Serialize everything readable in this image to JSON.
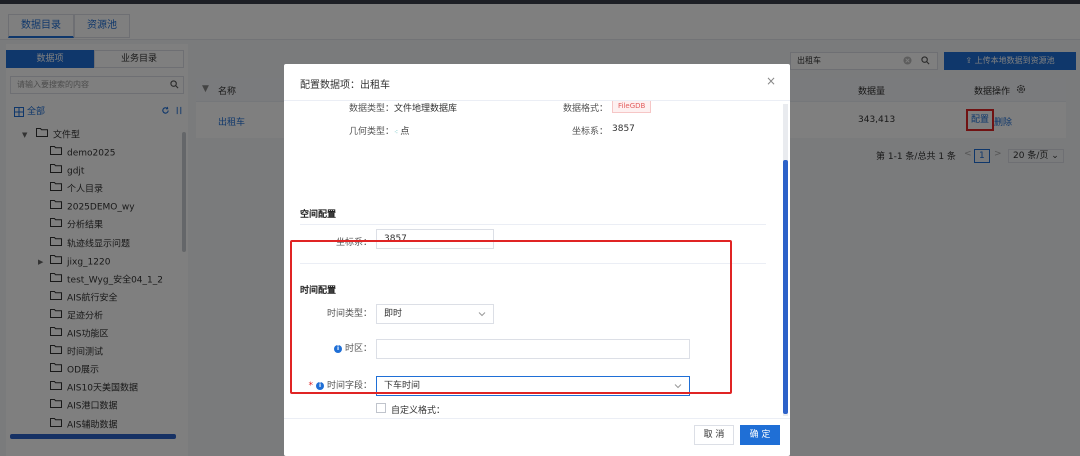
{
  "tabs": [
    "数据目录",
    "资源池"
  ],
  "left": {
    "segments": [
      "数据项",
      "业务目录"
    ],
    "search_placeholder": "请输入要搜索的内容",
    "all_label": "全部",
    "root_label": "文件型",
    "folders": [
      "demo2025",
      "gdjt",
      "个人目录",
      "2025DEMO_wy",
      "分析结果",
      "轨迹线显示问题",
      "jixg_1220",
      "test_Wyg_安全04_1_2",
      "AIS航行安全",
      "足迹分析",
      "AIS功能区",
      "时间测试",
      "OD展示",
      "AIS10天美国数据",
      "AIS港口数据",
      "AIS辅助数据"
    ]
  },
  "right": {
    "search_value": "出租车",
    "upload_label": "上传本地数据到资源池",
    "table": {
      "headers": {
        "name": "名称",
        "count": "数据量",
        "ops": "数据操作"
      },
      "row": {
        "name": "出租车",
        "count": "343,413",
        "config": "配置",
        "delete": "删除"
      }
    },
    "pagination": {
      "summary": "第 1-1 条/总共 1 条",
      "current": "1",
      "page_size": "20 条/页"
    }
  },
  "modal": {
    "title": "配置数据项：出租车",
    "close": "×",
    "info": {
      "data_type_label": "数据类型：",
      "data_type_value": "文件地理数据库",
      "data_format_label": "数据格式：",
      "data_format_value": "FileGDB",
      "geom_type_label": "几何类型：",
      "geom_type_value": "点",
      "crs_label": "坐标系：",
      "crs_value": "3857"
    },
    "spatial": {
      "title": "空间配置",
      "crs_label": "坐标系：",
      "crs_value": "3857"
    },
    "time": {
      "title": "时间配置",
      "type_label": "时间类型：",
      "type_value": "即时",
      "zone_label": "时区：",
      "zone_value": "",
      "field_label": "时间字段：",
      "field_value": "下车时间",
      "custom_format_label": "自定义格式："
    },
    "cancel": "取 消",
    "ok": "确 定"
  }
}
